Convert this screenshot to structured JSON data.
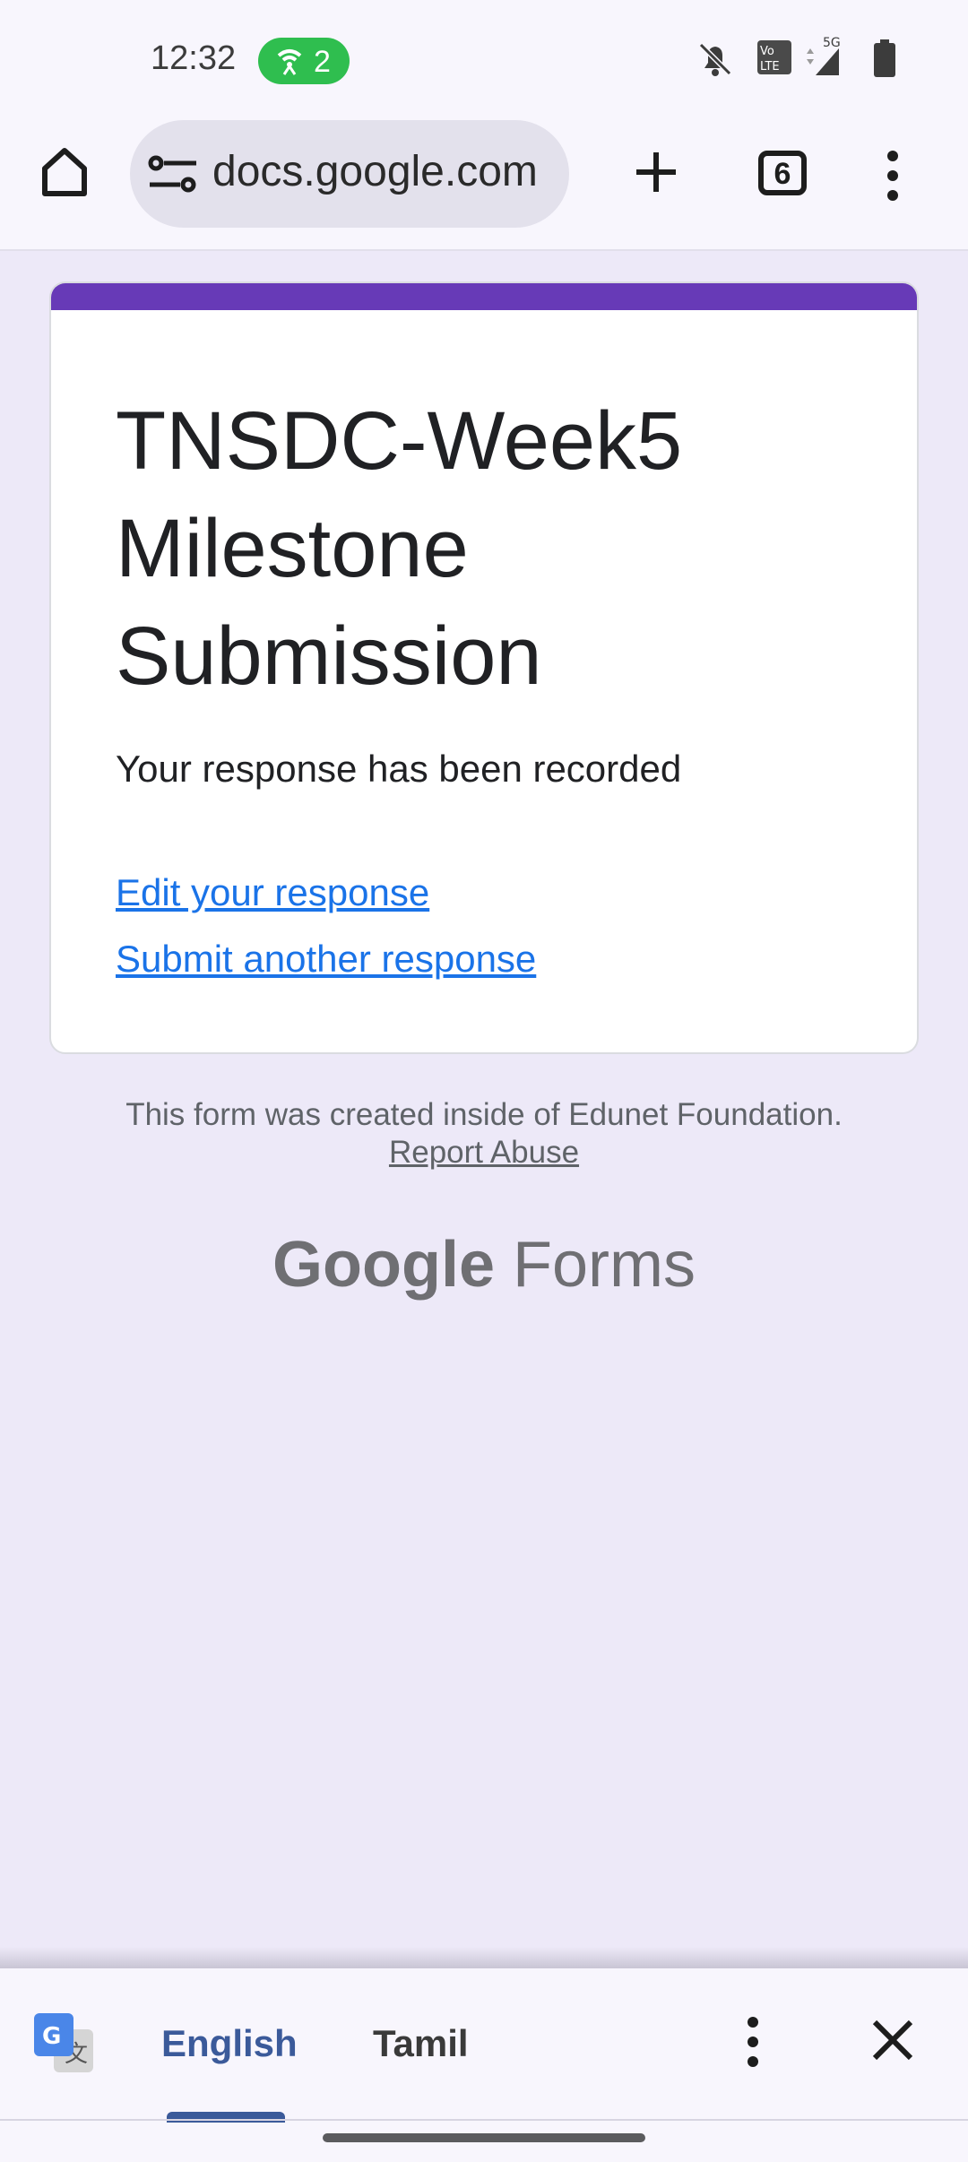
{
  "status_bar": {
    "time": "12:32",
    "hotspot_count": "2",
    "icons": [
      "hotspot-icon",
      "bell-off-icon",
      "volte-icon",
      "signal-5g-icon",
      "battery-icon"
    ],
    "network_label": "5G"
  },
  "toolbar": {
    "url": "docs.google.com",
    "tab_count": "6",
    "icons": [
      "home-icon",
      "tune-icon",
      "plus-icon",
      "tabs-icon",
      "more-vert-icon"
    ]
  },
  "form": {
    "title": "TNSDC-Week5 Milestone Submission",
    "confirmation": "Your response has been recorded",
    "edit_link": "Edit your response",
    "submit_another_link": "Submit another response",
    "accent_color": "#673ab7"
  },
  "footer": {
    "note": "This form was created inside of Edunet Foundation.",
    "report": "Report Abuse",
    "brand_google": "Google",
    "brand_forms": "Forms"
  },
  "translate_bar": {
    "source_lang": "English",
    "target_lang": "Tamil",
    "selected": "English",
    "icons": [
      "google-translate-icon",
      "more-vert-icon",
      "close-icon"
    ]
  }
}
